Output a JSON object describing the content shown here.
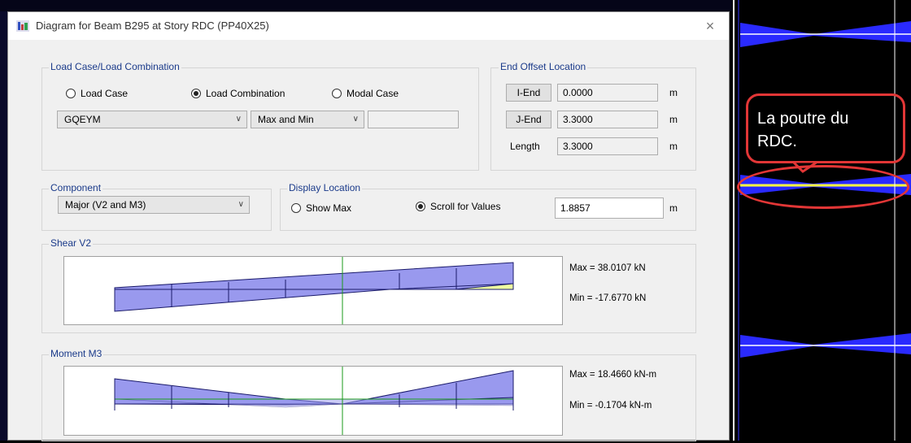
{
  "window": {
    "title": "Diagram for Beam B295 at Story RDC (PP40X25)",
    "close": "×"
  },
  "load_case": {
    "legend": "Load Case/Load Combination",
    "options": [
      "Load Case",
      "Load Combination",
      "Modal Case"
    ],
    "selected": "Load Combination",
    "combo_value": "GQEYM",
    "mode_value": "Max and Min",
    "extra_value": ""
  },
  "end_offset": {
    "legend": "End Offset Location",
    "i_end_label": "I-End",
    "i_end_value": "0.0000",
    "j_end_label": "J-End",
    "j_end_value": "3.3000",
    "length_label": "Length",
    "length_value": "3.3000",
    "unit": "m"
  },
  "component": {
    "legend": "Component",
    "value": "Major (V2 and M3)"
  },
  "display_location": {
    "legend": "Display Location",
    "options": [
      "Show Max",
      "Scroll for Values"
    ],
    "selected": "Scroll for Values",
    "value": "1.8857",
    "unit": "m"
  },
  "shear": {
    "legend": "Shear V2",
    "max": "Max = 38.0107 kN",
    "min": "Min = -17.6770 kN"
  },
  "moment": {
    "legend": "Moment M3",
    "max": "Max = 18.4660 kN-m",
    "min": "Min = -0.1704 kN-m"
  },
  "annotation": {
    "line1": "La poutre du",
    "line2": "RDC."
  },
  "colors": {
    "diagram_fill": "#9999ee",
    "diagram_stroke": "#1a1a6a",
    "cursor": "#1a9a1a",
    "annotation": "#e23636"
  }
}
